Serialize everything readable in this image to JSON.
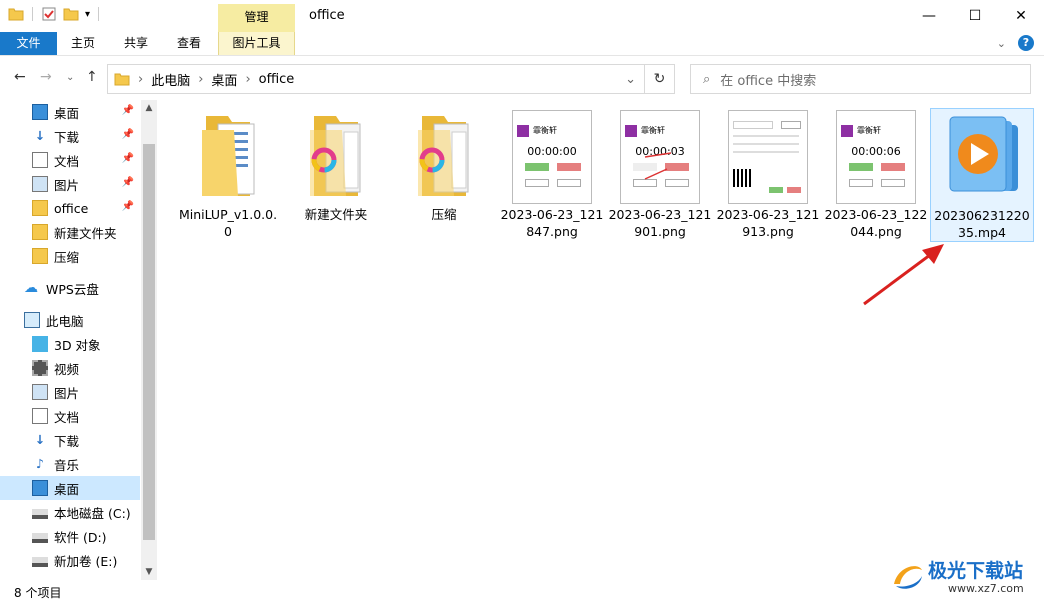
{
  "window": {
    "title": "office",
    "context_tab_group": "管理",
    "minimize": "—",
    "maximize": "☐",
    "close": "✕"
  },
  "ribbon": {
    "tabs": [
      "文件",
      "主页",
      "共享",
      "查看",
      "图片工具"
    ],
    "help": "?"
  },
  "address": {
    "path": [
      "此电脑",
      "桌面",
      "office"
    ],
    "search_placeholder": "在 office 中搜索"
  },
  "sidebar": {
    "quick_access": [
      {
        "label": "桌面",
        "pinned": true
      },
      {
        "label": "下载",
        "pinned": true
      },
      {
        "label": "文档",
        "pinned": true
      },
      {
        "label": "图片",
        "pinned": true
      },
      {
        "label": "office",
        "pinned": true
      },
      {
        "label": "新建文件夹",
        "pinned": false
      },
      {
        "label": "压缩",
        "pinned": false
      }
    ],
    "cloud": "WPS云盘",
    "this_pc": "此电脑",
    "pc_items": [
      "3D 对象",
      "视频",
      "图片",
      "文档",
      "下载",
      "音乐",
      "桌面",
      "本地磁盘 (C:)",
      "软件 (D:)",
      "新加卷 (E:)"
    ],
    "selected": "桌面"
  },
  "files": [
    {
      "name": "MiniLUP_v1.0.0.0",
      "type": "folder-docs"
    },
    {
      "name": "新建文件夹",
      "type": "folder-app"
    },
    {
      "name": "压缩",
      "type": "folder-app"
    },
    {
      "name": "2023-06-23_121847.png",
      "type": "png",
      "timer": "00:00:00",
      "brand": "霏衡轩"
    },
    {
      "name": "2023-06-23_121901.png",
      "type": "png",
      "timer": "00:00:03",
      "brand": "霏衡轩"
    },
    {
      "name": "2023-06-23_121913.png",
      "type": "png-qr"
    },
    {
      "name": "2023-06-23_122044.png",
      "type": "png",
      "timer": "00:00:06",
      "brand": "霏衡轩"
    },
    {
      "name": "20230623122035.mp4",
      "type": "mp4",
      "selected": true
    }
  ],
  "status": {
    "item_count": "8 个项目"
  },
  "watermark": {
    "name": "极光下载站",
    "url": "www.xz7.com"
  },
  "colors": {
    "accent": "#1979ca",
    "context_tab": "#f6eca2",
    "selection": "#cce8ff",
    "arrow": "#d9211f"
  }
}
